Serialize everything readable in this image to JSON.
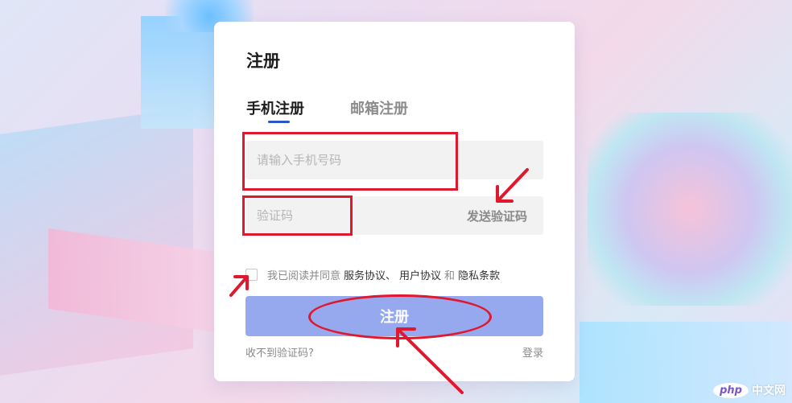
{
  "card": {
    "title": "注册",
    "tabs": [
      {
        "label": "手机注册",
        "active": true
      },
      {
        "label": "邮箱注册",
        "active": false
      }
    ],
    "phone_placeholder": "请输入手机号码",
    "code_placeholder": "验证码",
    "send_code_label": "发送验证码",
    "agree": {
      "prefix": "我已阅读并同意",
      "service_agreement": "服务协议、",
      "user_agreement": "用户协议",
      "and": "和",
      "privacy_terms": "隐私条款"
    },
    "submit_label": "注册",
    "no_code_label": "收不到验证码?",
    "login_label": "登录"
  },
  "colors": {
    "accent": "#2b55c7",
    "submit_bg": "#97a9ee",
    "annotation": "#e0182d"
  },
  "watermark": {
    "logo": "php",
    "text": "中文网"
  }
}
